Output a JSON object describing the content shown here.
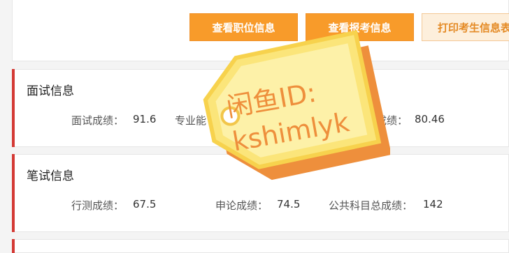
{
  "buttons": {
    "view_position": "查看职位信息",
    "view_registration": "查看报考信息",
    "print_candidate": "打印考生信息表"
  },
  "interview": {
    "title": "面试信息",
    "items": [
      {
        "label": "面试成绩：",
        "value": "91.6"
      },
      {
        "label": "专业能",
        "value": ""
      },
      {
        "label": "成绩：",
        "value": "80.46"
      }
    ]
  },
  "written": {
    "title": "笔试信息",
    "items": [
      {
        "label": "行测成绩：",
        "value": "67.5"
      },
      {
        "label": "申论成绩：",
        "value": "74.5"
      },
      {
        "label": "公共科目总成绩：",
        "value": "142"
      }
    ]
  },
  "watermark": {
    "line1": "闲鱼ID:",
    "line2": "kshimlyk"
  },
  "colors": {
    "accent_orange": "#f89b2a",
    "section_bar_red": "#d43a35",
    "tag_yellow": "#fbe57a",
    "tag_orange": "#ee8f3c"
  }
}
